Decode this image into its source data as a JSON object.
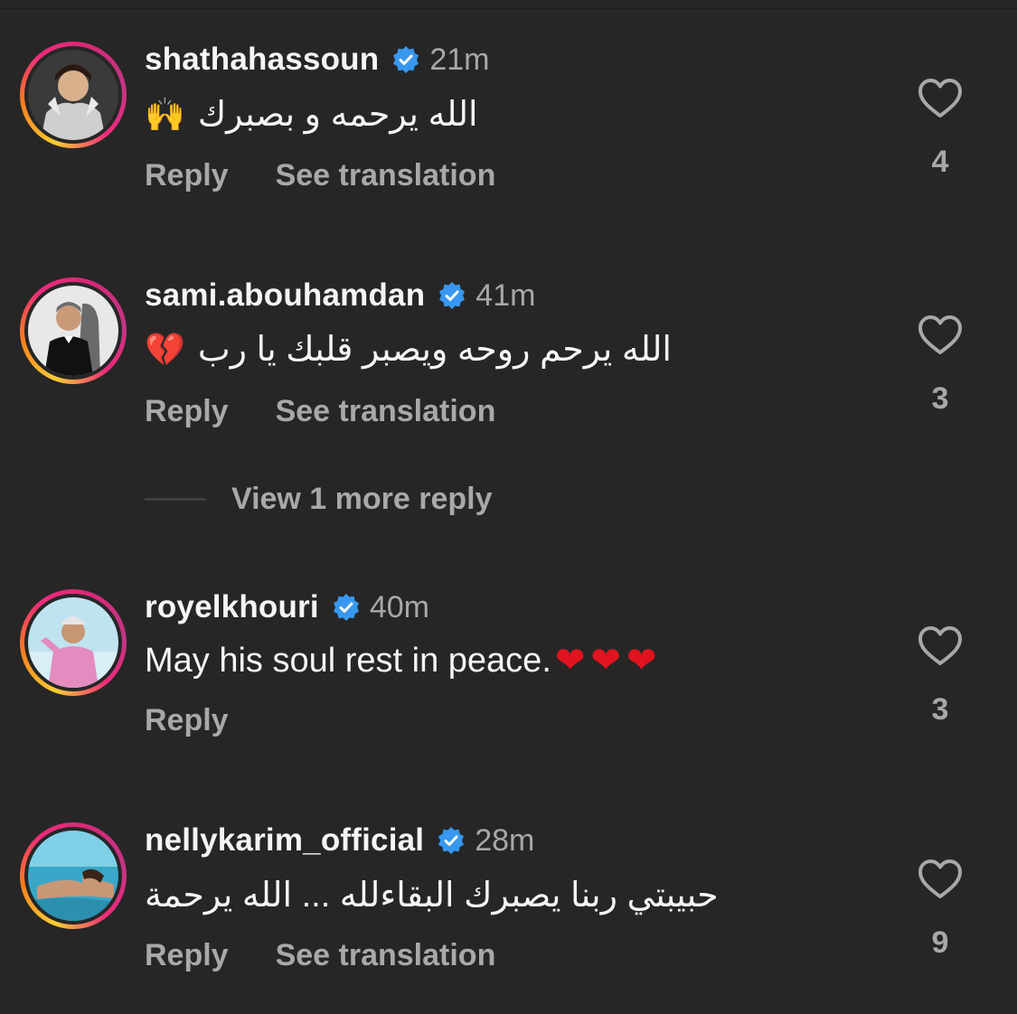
{
  "comments": [
    {
      "username": "shathahassoun",
      "time": "21m",
      "text": "الله يرحمه و بصبرك",
      "emoji": "🙌",
      "reply": "Reply",
      "translate": "See translation",
      "likes": "4"
    },
    {
      "username": "sami.abouhamdan",
      "time": "41m",
      "text": "الله يرحم روحه ويصبر قلبك يا رب",
      "emoji": "💔",
      "reply": "Reply",
      "translate": "See translation",
      "likes": "3",
      "more_replies": "View 1 more reply"
    },
    {
      "username": "royelkhouri",
      "time": "40m",
      "text": "May his soul rest in peace.",
      "emoji": "❤❤❤",
      "reply": "Reply",
      "likes": "3"
    },
    {
      "username": "nellykarim_official",
      "time": "28m",
      "text": "حبيبتي ربنا يصبرك البقاءلله ... الله يرحمة",
      "reply": "Reply",
      "translate": "See translation",
      "likes": "9"
    }
  ],
  "colors": {
    "background": "#262626",
    "verified": "#3897f0",
    "secondary_text": "#a8a8a8",
    "primary_text": "#f5f5f5"
  }
}
